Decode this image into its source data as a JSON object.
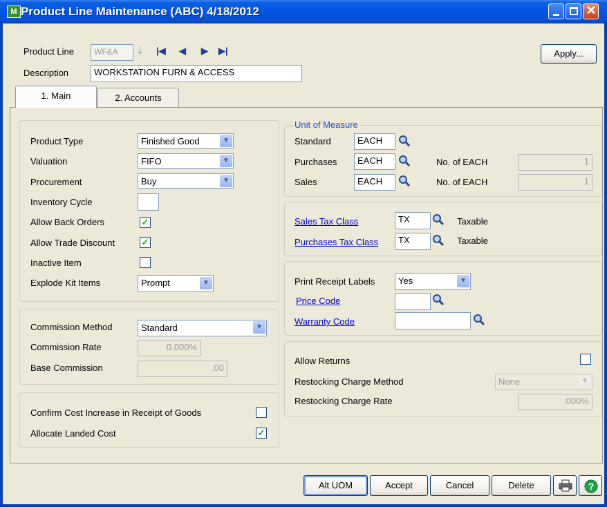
{
  "window": {
    "title": "Product Line Maintenance (ABC) 4/18/2012",
    "app_icon": "M"
  },
  "header": {
    "product_line_label": "Product Line",
    "product_line_value": "WF&A",
    "description_label": "Description",
    "description_value": "WORKSTATION FURN & ACCESS",
    "apply_label": "Apply..."
  },
  "tabs": [
    {
      "label": "1. Main",
      "active": true
    },
    {
      "label": "2. Accounts",
      "active": false
    }
  ],
  "main": {
    "product_type_label": "Product Type",
    "product_type_value": "Finished Good",
    "valuation_label": "Valuation",
    "valuation_value": "FIFO",
    "procurement_label": "Procurement",
    "procurement_value": "Buy",
    "inventory_cycle_label": "Inventory Cycle",
    "inventory_cycle_value": "",
    "allow_back_orders_label": "Allow Back Orders",
    "allow_back_orders_checked": true,
    "allow_trade_discount_label": "Allow Trade Discount",
    "allow_trade_discount_checked": true,
    "inactive_item_label": "Inactive Item",
    "inactive_item_checked": false,
    "explode_kit_label": "Explode Kit Items",
    "explode_kit_value": "Prompt"
  },
  "commission": {
    "method_label": "Commission Method",
    "method_value": "Standard",
    "rate_label": "Commission Rate",
    "rate_value": "0.000%",
    "base_label": "Base Commission",
    "base_value": ".00"
  },
  "cost": {
    "confirm_label": "Confirm Cost Increase in Receipt of Goods",
    "confirm_checked": false,
    "landed_label": "Allocate Landed Cost",
    "landed_checked": true
  },
  "uom": {
    "group_label": "Unit of Measure",
    "standard_label": "Standard",
    "standard_value": "EACH",
    "purchases_label": "Purchases",
    "purchases_value": "EACH",
    "purchases_no_label": "No. of EACH",
    "purchases_no_value": "1",
    "sales_label": "Sales",
    "sales_value": "EACH",
    "sales_no_label": "No. of EACH",
    "sales_no_value": "1"
  },
  "tax": {
    "sales_label": "Sales Tax Class",
    "sales_value": "TX",
    "sales_desc": "Taxable",
    "purchases_label": "Purchases Tax Class",
    "purchases_value": "TX",
    "purchases_desc": "Taxable"
  },
  "receipt": {
    "print_label": "Print Receipt Labels",
    "print_value": "Yes",
    "price_code_label": "Price Code",
    "price_code_value": "",
    "warranty_label": "Warranty Code",
    "warranty_value": ""
  },
  "returns": {
    "allow_label": "Allow Returns",
    "allow_checked": false,
    "method_label": "Restocking Charge Method",
    "method_value": "None",
    "rate_label": "Restocking Charge Rate",
    "rate_value": ".000%"
  },
  "footer": {
    "alt_uom_label": "Alt UOM",
    "accept_label": "Accept",
    "cancel_label": "Cancel",
    "delete_label": "Delete"
  },
  "colors": {
    "titlebar": "#0055e5",
    "dialog": "#ece9d8",
    "link": "#0000cc",
    "group_caption": "#1f4fd0",
    "check": "#21a121"
  }
}
